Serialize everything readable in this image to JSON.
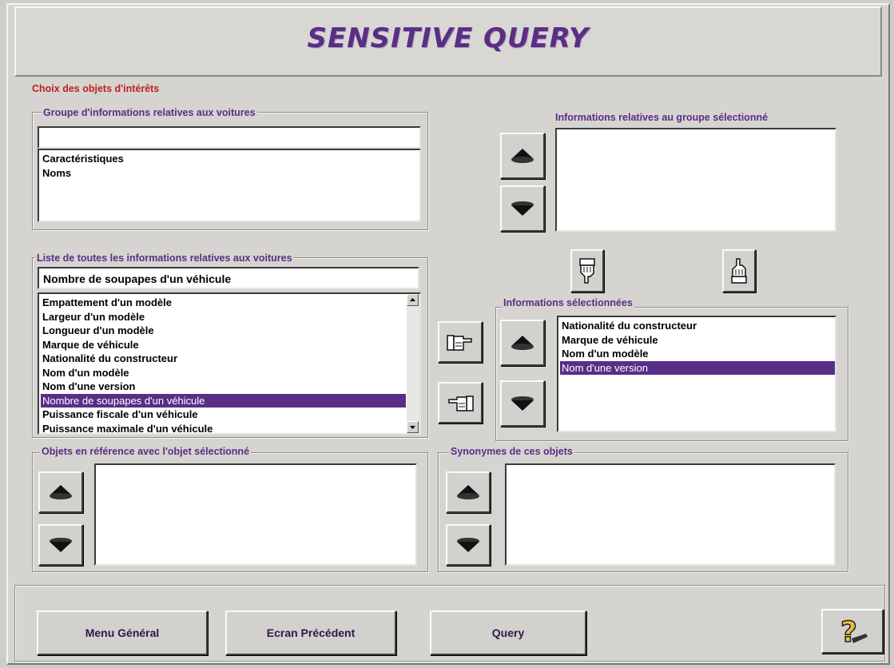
{
  "title": "SENSITIVE QUERY",
  "section_label": "Choix des objets d'intérêts",
  "groups": {
    "label": "Groupe d'informations relatives aux voitures",
    "input_value": "",
    "items": [
      "Caractéristiques",
      "Noms"
    ]
  },
  "group_info": {
    "label": "Informations relatives au groupe sélectionné",
    "items": []
  },
  "all_info": {
    "label": "Liste de toutes les informations relatives aux voitures",
    "input_value": "Nombre de soupapes d'un véhicule",
    "items": [
      "Empattement d'un modèle",
      "Largeur d'un modèle",
      "Longueur d'un modèle",
      "Marque de véhicule",
      "Nationalité du constructeur",
      "Nom d'un modèle",
      "Nom d'une version",
      "Nombre de soupapes d'un véhicule",
      "Puissance fiscale d'un véhicule",
      "Puissance maximale d'un véhicule"
    ],
    "selected_index": 7
  },
  "selected_info": {
    "label": "Informations sélectionnées",
    "items": [
      "Nationalité du constructeur",
      "Marque de véhicule",
      "Nom d'un modèle",
      "Nom d'une version"
    ],
    "selected_index": 3
  },
  "references": {
    "label": "Objets en référence avec l'objet sélectionné",
    "items": []
  },
  "synonyms": {
    "label": "Synonymes de ces objets",
    "items": []
  },
  "buttons": {
    "menu": "Menu Général",
    "previous": "Ecran Précédent",
    "query": "Query"
  },
  "icons": {
    "up": "arrow-up-icon",
    "down": "arrow-down-icon",
    "add": "pointing-hand-right-icon",
    "remove": "pointing-hand-left-icon",
    "point_down": "pointing-hand-down-icon",
    "point_up": "pointing-hand-up-icon",
    "help": "help-question-icon"
  },
  "colors": {
    "accent": "#5b2d86",
    "section_label": "#c0201f",
    "selection": "#5a2d88"
  }
}
